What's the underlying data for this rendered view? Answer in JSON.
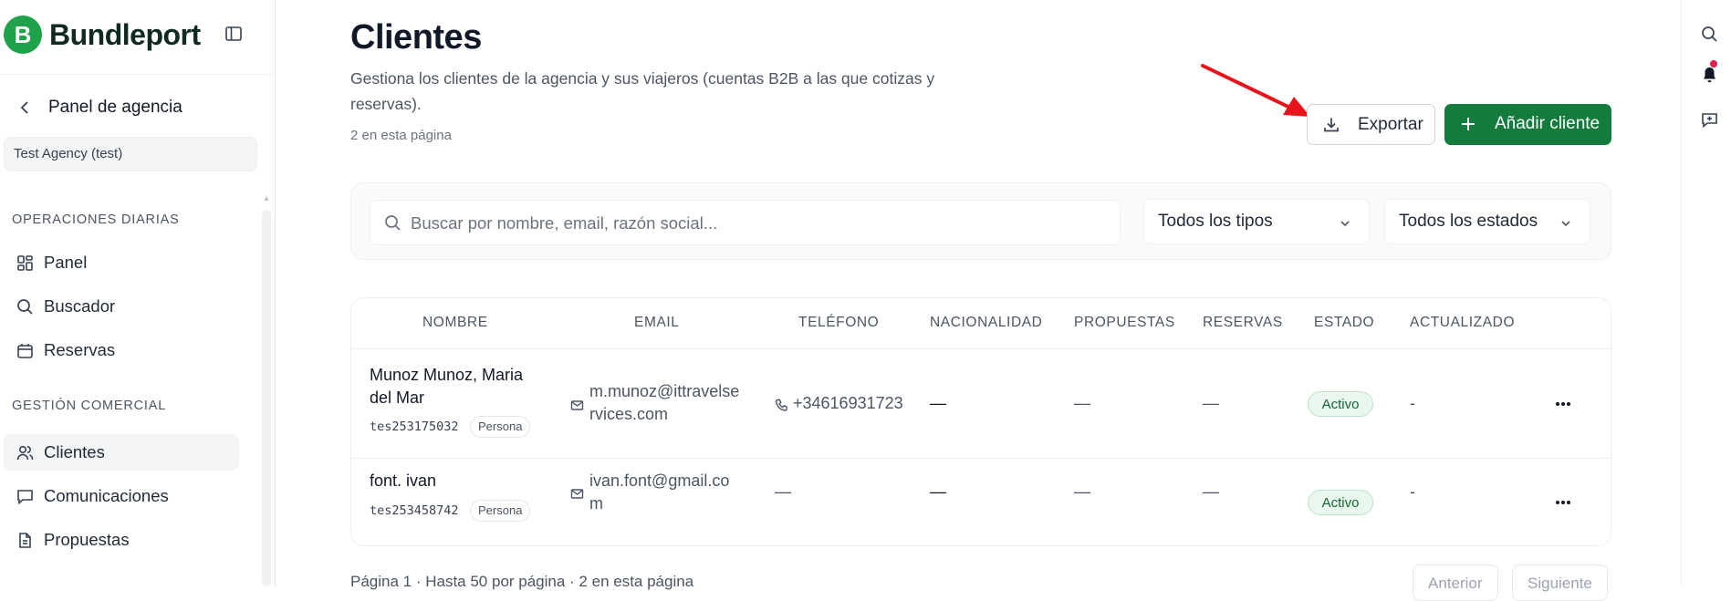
{
  "brand": {
    "logo_mark": "B",
    "name": "Bundleport"
  },
  "sidebar": {
    "back_label": "Panel de agencia",
    "agency": "Test Agency (test)",
    "sections": [
      {
        "title": "OPERACIONES DIARIAS",
        "items": [
          {
            "label": "Panel",
            "icon": "dashboard-icon"
          },
          {
            "label": "Buscador",
            "icon": "search-icon"
          },
          {
            "label": "Reservas",
            "icon": "calendar-icon"
          }
        ]
      },
      {
        "title": "GESTIÓN COMERCIAL",
        "items": [
          {
            "label": "Clientes",
            "icon": "users-icon",
            "active": true
          },
          {
            "label": "Comunicaciones",
            "icon": "chat-icon"
          },
          {
            "label": "Propuestas",
            "icon": "document-icon"
          }
        ]
      }
    ]
  },
  "header": {
    "title": "Clientes",
    "description": "Gestiona los clientes de la agencia y sus viajeros (cuentas B2B a las que cotizas y reservas).",
    "count": "2 en esta página",
    "export_label": "Exportar",
    "add_label": "Añadir cliente"
  },
  "filters": {
    "search_placeholder": "Buscar por nombre, email, razón social...",
    "type_value": "Todos los tipos",
    "status_value": "Todos los estados"
  },
  "table": {
    "columns": [
      "NOMBRE",
      "EMAIL",
      "TELÉFONO",
      "NACIONALIDAD",
      "PROPUESTAS",
      "RESERVAS",
      "ESTADO",
      "ACTUALIZADO"
    ],
    "rows": [
      {
        "name": "Munoz Munoz, Maria del Mar",
        "code": "tes253175032",
        "type": "Persona",
        "email": "m.munoz@ittravelservices.com",
        "phone": "+34616931723",
        "nationality": "—",
        "proposals": "—",
        "bookings": "—",
        "status": "Activo",
        "updated": "-"
      },
      {
        "name": "font. ivan",
        "code": "tes253458742",
        "type": "Persona",
        "email": "ivan.font@gmail.com",
        "phone": "—",
        "nationality": "—",
        "proposals": "—",
        "bookings": "—",
        "status": "Activo",
        "updated": "-"
      }
    ]
  },
  "footer": {
    "text": "Página 1 · Hasta 50 por página · 2 en esta página",
    "prev_label": "Anterior",
    "next_label": "Siguiente"
  },
  "colors": {
    "brand_green": "#1ea34a",
    "primary_button": "#137b3b",
    "annotation_arrow": "#e8141b"
  }
}
